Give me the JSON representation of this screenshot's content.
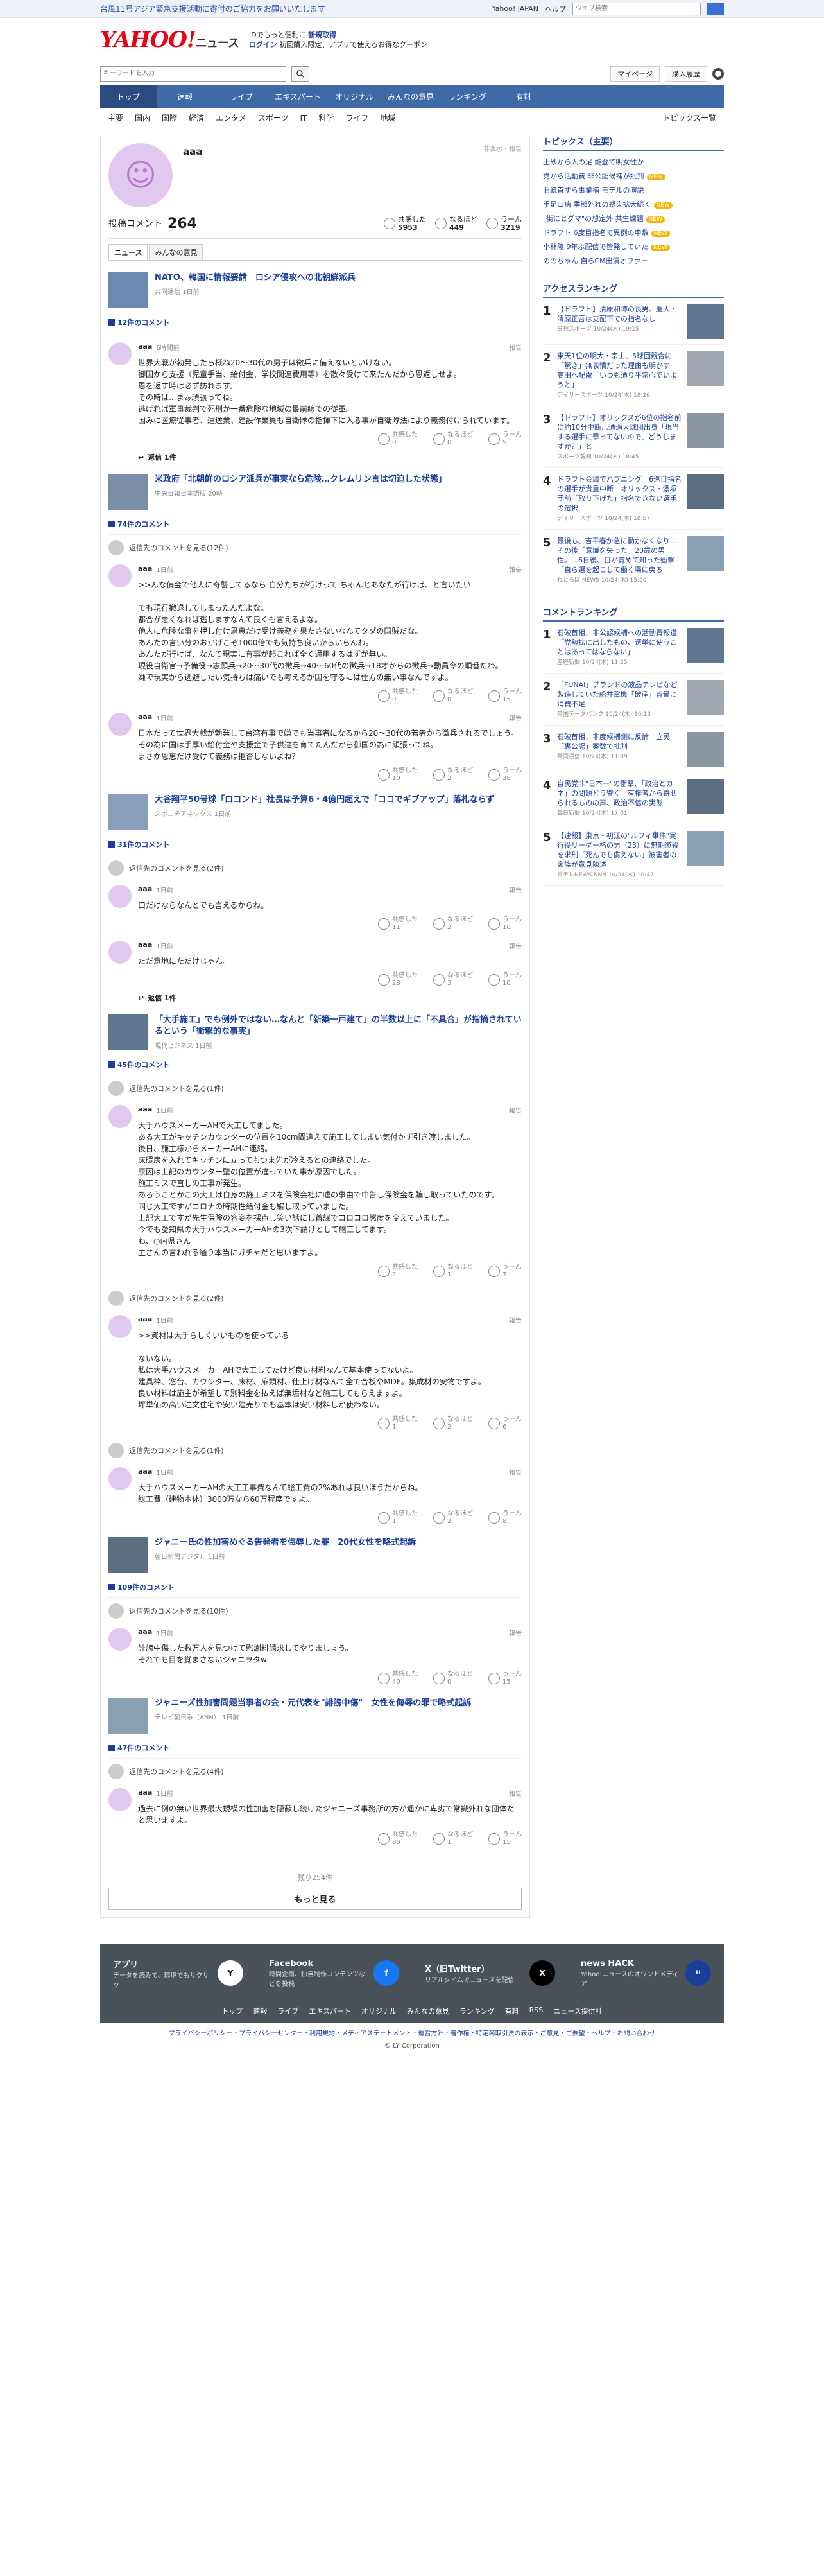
{
  "banner": {
    "message": "台風11号アジア緊急支援活動に寄付のご協力をお願いいたします",
    "links": [
      "Yahoo! JAPAN",
      "ヘルプ"
    ],
    "search_placeholder": "ウェブ検索"
  },
  "header": {
    "logo": "YAHOO!",
    "logo_sub": "ニュース",
    "line1": "IDでもっと便利に",
    "line1_link": "新規取得",
    "line2": "ログイン",
    "line3": "初回購入限定、アプリで使えるお得なクーポン"
  },
  "search": {
    "placeholder": "キーワードを入力",
    "mypage": "マイページ",
    "buy": "購入履歴"
  },
  "gnav": [
    "トップ",
    "速報",
    "ライブ",
    "エキスパート",
    "オリジナル",
    "みんなの意見",
    "ランキング",
    "有料"
  ],
  "subnav": [
    "主要",
    "国内",
    "国際",
    "経済",
    "エンタメ",
    "スポーツ",
    "IT",
    "科学",
    "ライフ",
    "地域"
  ],
  "subnav_right": "トピックス一覧",
  "profile": {
    "name": "aaa",
    "report": "非表示・報告",
    "comments_label": "投稿コメント",
    "comments": "264",
    "stats": [
      {
        "label": "共感した",
        "value": "5953"
      },
      {
        "label": "なるほど",
        "value": "449"
      },
      {
        "label": "うーん",
        "value": "3219"
      }
    ],
    "tabs": [
      "ニュース",
      "みんなの意見"
    ]
  },
  "articles": [
    {
      "title": "NATO、韓国に情報要請　ロシア侵攻への北朝鮮派兵",
      "src": "共同通信 1日前",
      "count": "12件のコメント",
      "comments": [
        {
          "name": "aaa",
          "time": "6時間前",
          "text": "世界大戦が勃発したら概ね20〜30代の男子は徴兵に備えないといけない。\n御国から支援（児童手当、給付金、学校関連費用等）を散々受けて来たんだから恩返しせよ。\n恩を返す時は必ず訪れます。\nその時は...まぁ頑張ってね。\n逃げれば軍事裁判で死刑か一番危険な地域の最前線での従軍。\n因みに医療従事者、運送業、建設作業員も自衛隊の指揮下に入る事が自衛隊法により義務付けられています。",
          "r": [
            "0",
            "0",
            "5"
          ],
          "reply": "返信 1件"
        }
      ]
    },
    {
      "title": "米政府「北朝鮮のロシア派兵が事実なら危険…クレムリン言は切迫した状態」",
      "src": "中央日報日本語版 20時",
      "count": "74件のコメント",
      "parent": "返信先のコメントを見る(12件)",
      "comments": [
        {
          "name": "aaa",
          "time": "1日前",
          "text": ">>んな偏金で他人に奇襲してるなら 自分たちが行けって ちゃんとあなたが行けば、と言いたい\n\nでも現行撤退してしまったんだよな。\n都合が悪くなれば逃しますなんて良くも言えるよな。\n他人に危険な事を押し付け恩恵だけ受け義務を果たさないなんてタダの国賊だな。\nあんたの言い分のおかげこそ1000倍でも気持ち良いからいらんわ。\nあんたが行けば、なんて現実に有事が起これば全く通用するはずが無い。\n現役自衛官→予備役→志願兵→20〜30代の徴兵→40〜60代の徴兵→18才からの徴兵→動員令の順番だわ。\n嫌で現実から逃避したい気持ちは痛いでも考えるが国を守るには仕方の無い事なんですよ。",
          "r": [
            "0",
            "0",
            "15"
          ]
        },
        {
          "name": "aaa",
          "time": "1日前",
          "text": "日本だって世界大戦が勃発して台湾有事で嫌でも当事者になるから20〜30代の若者から徴兵されるでしょう。\nその為に国は手厚い給付金や支援金で子供達を育てたんだから御国の為に頑張ってね。\nまさか恩恵だけ受けて義務は拒否しないよね？",
          "r": [
            "10",
            "2",
            "38"
          ]
        }
      ]
    },
    {
      "title": "大谷翔平50号球「ロコンド」社長は予算6・4億円超えで「ココでギブアップ」落札ならず",
      "src": "スポニチアネックス 1日前",
      "count": "31件のコメント",
      "parent": "返信先のコメントを見る(2件)",
      "comments": [
        {
          "name": "aaa",
          "time": "1日前",
          "text": "口だけならなんとでも言えるからね。",
          "r": [
            "11",
            "2",
            "10"
          ]
        },
        {
          "name": "aaa",
          "time": "1日前",
          "text": "ただ意地にただけじゃん。",
          "r": [
            "28",
            "3",
            "10"
          ],
          "reply": "返信 1件"
        }
      ]
    },
    {
      "title": "「大手施工」でも例外ではない…なんと「新築一戸建て」の半数以上に「不具合」が指摘されているという「衝撃的な事実」",
      "src": "現代ビジネス 1日前",
      "count": "45件のコメント",
      "parent": "返信先のコメントを見る(1件)",
      "comments": [
        {
          "name": "aaa",
          "time": "1日前",
          "text": "大手ハウスメーカーAHで大工してました。\nある大工がキッチンカウンターの位置を10cm間違えて施工してしまい気付かず引き渡しました。\n後日、施主様からメーカーAHに連絡。\n床暖房を入れてキッチンに立ってもつま先が冷えるとの連絡でした。\n原因は上記のカウンター壁の位置が違っていた事が原因でした。\n施工ミスで直しの工事が発生。\nあろうことかこの大工は自身の施工ミスを保険会社に嘘の事由で申告し保険金を騙し取っていたのです。\n同じ大工ですがコロナの時期性給付金も騙し取っていました。\n上記大工ですが先生保険の容姿を採点し笑い話にし首謀でコロコロ態度を変えていました。\n今でも愛知県の大手ハウスメーカーAHの3次下請けとして施工してます。\nね、○内県さん\n主さんの言われる通り本当にガチャだと思いますよ。",
          "r": [
            "2",
            "1",
            "7"
          ]
        }
      ]
    },
    {
      "title": "",
      "src": "",
      "count": "",
      "parent": "返信先のコメントを見る(2件)",
      "comments": [
        {
          "name": "aaa",
          "time": "1日前",
          "text": ">>資材は大手らしくいいものを使っている\n\nないない。\n私は大手ハウスメーカーAHで大工してたけど良い材料なんて基本使ってないよ。\n建具枠、窓台、カウンター、床材、扉類材、仕上げ材なんて全て合板やMDF。集成材の安物ですよ。\n良い材料は施主が希望して別料金を払えば無垢材など施工してもらえますよ。\n坪単価の高い注文住宅や安い建売りでも基本は安い材料しか使わない。",
          "r": [
            "1",
            "2",
            "6"
          ]
        }
      ]
    },
    {
      "title": "",
      "src": "",
      "count": "",
      "parent": "返信先のコメントを見る(1件)",
      "comments": [
        {
          "name": "aaa",
          "time": "1日前",
          "text": "大手ハウスメーカーAHの大工工事費なんて総工費の2%あれば良いほうだからね。\n総工費（建物本体）3000万なら60万程度ですよ。",
          "r": [
            "1",
            "2",
            "8"
          ]
        }
      ]
    },
    {
      "title": "ジャニー氏の性加害めぐる告発者を侮辱した罪　20代女性を略式起訴",
      "src": "朝日新聞デジタル 1日前",
      "count": "109件のコメント",
      "parent": "返信先のコメントを見る(10件)",
      "comments": [
        {
          "name": "aaa",
          "time": "1日前",
          "text": "誹謗中傷した数万人を見つけて慰謝料請求してやりましょう。\nそれでも目を覚まさないジャニヲタw",
          "r": [
            "40",
            "0",
            "15"
          ]
        }
      ]
    },
    {
      "title": "ジャニーズ性加害問題当事者の会・元代表を\"誹謗中傷\"　女性を侮辱の罪で略式起訴",
      "src": "テレビ朝日系（ANN） 1日前",
      "count": "47件のコメント",
      "parent": "返信先のコメントを見る(4件)",
      "comments": [
        {
          "name": "aaa",
          "time": "1日前",
          "text": "過去に例の無い世界最大規模の性加害を隠蔽し続けたジャニーズ事務所の方が遥かに卑劣で常識外れな団体だと思いますよ。",
          "r": [
            "80",
            "1",
            "15"
          ]
        }
      ]
    }
  ],
  "remaining": "残り254件",
  "more": "もっと見る",
  "side": {
    "topics_title": "トピックス（主要）",
    "topics": [
      {
        "t": "土砂から人の足 能登で明女性か",
        "n": ""
      },
      {
        "t": "党から活動費 非公認候補が批判",
        "n": "NEW"
      },
      {
        "t": "旧統首すら事業補 モデルの演説",
        "n": ""
      },
      {
        "t": "手足口病 季節外れの感染拡大続く",
        "n": "NEW"
      },
      {
        "t": "\"街にヒグマ\"の想定外 共生課題",
        "n": "NEW"
      },
      {
        "t": "ドラフト 6度目指名で異例の申敷",
        "n": "NEW"
      },
      {
        "t": "小林陵 9年ぶ配信で皆発していた",
        "n": "NEW"
      },
      {
        "t": "ののちゃん 自らCM出演オファー",
        "n": ""
      }
    ],
    "access_title": "アクセスランキング",
    "access": [
      {
        "no": "1",
        "t": "【ドラフト】清原和博の長男、慶大・清原正吾は支配下での指名なし",
        "m": "日刊スポーツ 10/24(木) 19:15"
      },
      {
        "no": "2",
        "t": "東天1位の明大・宗山、5球団競合に「驚き」無表情だった理由も明かす　高田へ配慮「いつも通り平常心でいようと」",
        "m": "デイリースポーツ 10/24(木) 18:26"
      },
      {
        "no": "3",
        "t": "【ドラフト】オリックスが6位の指名前に約10分中断…通過大球団出身「現当する選手に撃ってないので、どうしますか？」と",
        "m": "スポーツ報知 10/24(木) 18:45"
      },
      {
        "no": "4",
        "t": "ドラフト会議でハプニング　6巡目指名の選手が貴重中断　オリックス・濃塚団前「取り下げた」指名できない選手の選択",
        "m": "デイリースポーツ 10/24(木) 18:57"
      },
      {
        "no": "5",
        "t": "最後も、吉平春か急に動かなくなり…その後「意識を失った」20歳の男性。…6日後、目が覚めて知った衝撃「自ら選を起こして働く場に戻る",
        "m": "ねとらぼ NEWS 10/24(木) 15:00"
      }
    ],
    "cmt_title": "コメントランキング",
    "cmt": [
      {
        "no": "1",
        "t": "石破首相、非公認候補への活動費報道「党勢拡に出したもの、選挙に使うことはあってはならない」",
        "m": "産経新聞 10/24(木) 11:25"
      },
      {
        "no": "2",
        "t": "「FUNAI」ブランドの液晶テレビなど製造していた船井電機「破産」背景に消費不足",
        "m": "帝国データバンク 10/24(木) 16:13"
      },
      {
        "no": "3",
        "t": "石破首相、非度候補側に反論　立民「裏公認」案数で批判",
        "m": "共同通信 10/24(木) 11:09"
      },
      {
        "no": "4",
        "t": "自民党非\"日本一\"の衝撃、「政治とカネ」の問題どう響く　有権者から寄せられるものの声、政治不信の実態",
        "m": "毎日新聞 10/24(木) 17:01"
      },
      {
        "no": "5",
        "t": "【速報】東京・初江の\"ルフィ事件\"実行役リーダー格の男（23）に無期懲役を求刑「死んでも償えない」被害者の家族が意見陳述",
        "m": "日テレNEWS NNN 10/24(木) 10:47"
      }
    ]
  },
  "footer": {
    "apps": [
      {
        "name": "アプリ",
        "desc": "データを読みて、環境でもサクサク"
      },
      {
        "name": "Facebook",
        "desc": "時間企画、独自制作コンテンツなどを投稿"
      },
      {
        "name": "X（旧Twitter）",
        "desc": "リアルタイムでニュースを配信"
      },
      {
        "name": "news HACK",
        "desc": "Yahoo!ニュースのオウンドメディア"
      }
    ],
    "nav": [
      "トップ",
      "速報",
      "ライブ",
      "エキスパート",
      "オリジナル",
      "みんなの意見",
      "ランキング",
      "有料",
      "RSS",
      "ニュース提供社"
    ],
    "legal": "プライバシーポリシー・プライバシーセンター・利用規約・メディアステートメント・運営方針・著作権・特定商取引法の表示・ご意見・ご要望・ヘルプ・お問い合わせ",
    "copy": "© LY Corporation"
  }
}
